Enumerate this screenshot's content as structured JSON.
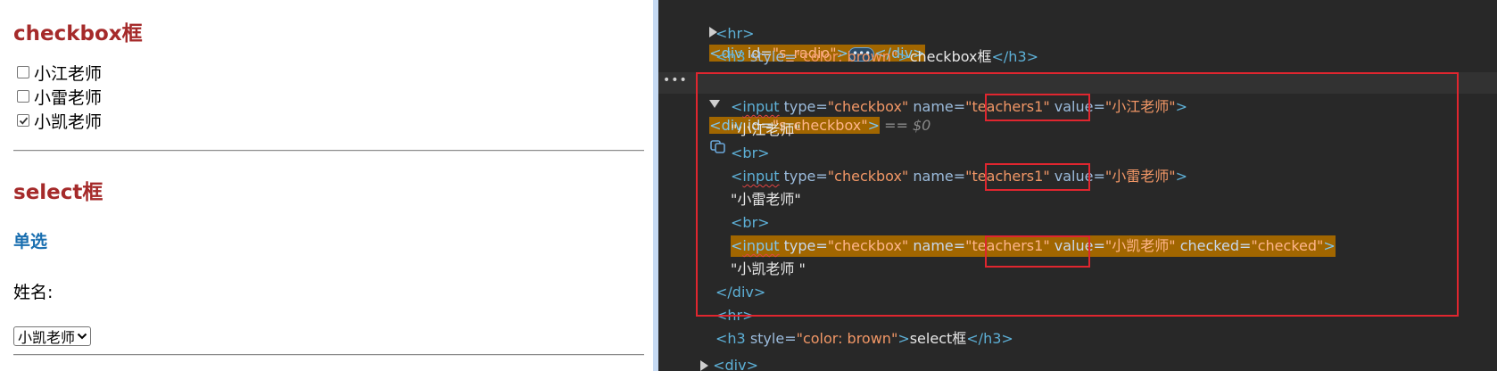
{
  "preview": {
    "checkbox_heading": "checkbox框",
    "checkboxes": [
      {
        "label": "小江老师",
        "checked": false
      },
      {
        "label": "小雷老师",
        "checked": false
      },
      {
        "label": "小凯老师",
        "checked": true
      }
    ],
    "select_heading": "select框",
    "single_heading": "单选",
    "name_label": "姓名:",
    "select_value": "小凯老师"
  },
  "devtools": {
    "lines": {
      "l0": {
        "open": "<",
        "tag": "div",
        "attr": " id=",
        "val": "\"s_radio\"",
        "close": ">",
        "end": "</div>"
      },
      "l1": {
        "text": "<hr>"
      },
      "l2": {
        "open": "<h3",
        "attr": " style=",
        "val": "\"color: brown\"",
        "close": ">",
        "inner": "checkbox框",
        "end": "</h3>"
      },
      "l3": {
        "open": "<div",
        "attr": " id=",
        "val": "\"s_checkbox\"",
        "close": ">",
        "eq": " == $0"
      },
      "l4": {
        "open": "<",
        "tag": "input",
        "a1": " type=",
        "v1": "\"checkbox\"",
        "a2": " name=",
        "v2": "\"teachers1\"",
        "a3": " value=",
        "v3": "\"小江老师\"",
        "close": ">"
      },
      "l5": {
        "text": "\"小江老师\""
      },
      "l6": {
        "text": "<br>"
      },
      "l7": {
        "open": "<",
        "tag": "input",
        "a1": " type=",
        "v1": "\"checkbox\"",
        "a2": " name=",
        "v2": "\"teachers1\"",
        "a3": " value=",
        "v3": "\"小雷老师\"",
        "close": ">"
      },
      "l8": {
        "text": "\"小雷老师\""
      },
      "l9": {
        "text": "<br>"
      },
      "l10": {
        "open": "<",
        "tag": "input",
        "a1": " type=",
        "v1": "\"checkbox\"",
        "a2": " name=",
        "v2": "\"teachers1\"",
        "a3": " value=",
        "v3": "\"小凯老师\"",
        "a4": " checked=",
        "v4": "\"checked\"",
        "close": ">"
      },
      "l11": {
        "text": "\"小凯老师 \""
      },
      "l12": {
        "text": "</div>"
      },
      "l13": {
        "text": "<hr>"
      },
      "l14": {
        "open": "<h3",
        "attr": " style=",
        "val": "\"color: brown\"",
        "close": ">",
        "inner": "select框",
        "end": "</h3>"
      },
      "l15": {
        "text": "<div>"
      }
    },
    "gutter_dots": "•••",
    "badge": "•••"
  },
  "colors": {
    "heading_brown": "#a52a2a",
    "subheading_blue": "#1a6fb0",
    "devtools_bg": "#282828",
    "highlight": "#a16600",
    "annotation_red": "#e0262f"
  }
}
